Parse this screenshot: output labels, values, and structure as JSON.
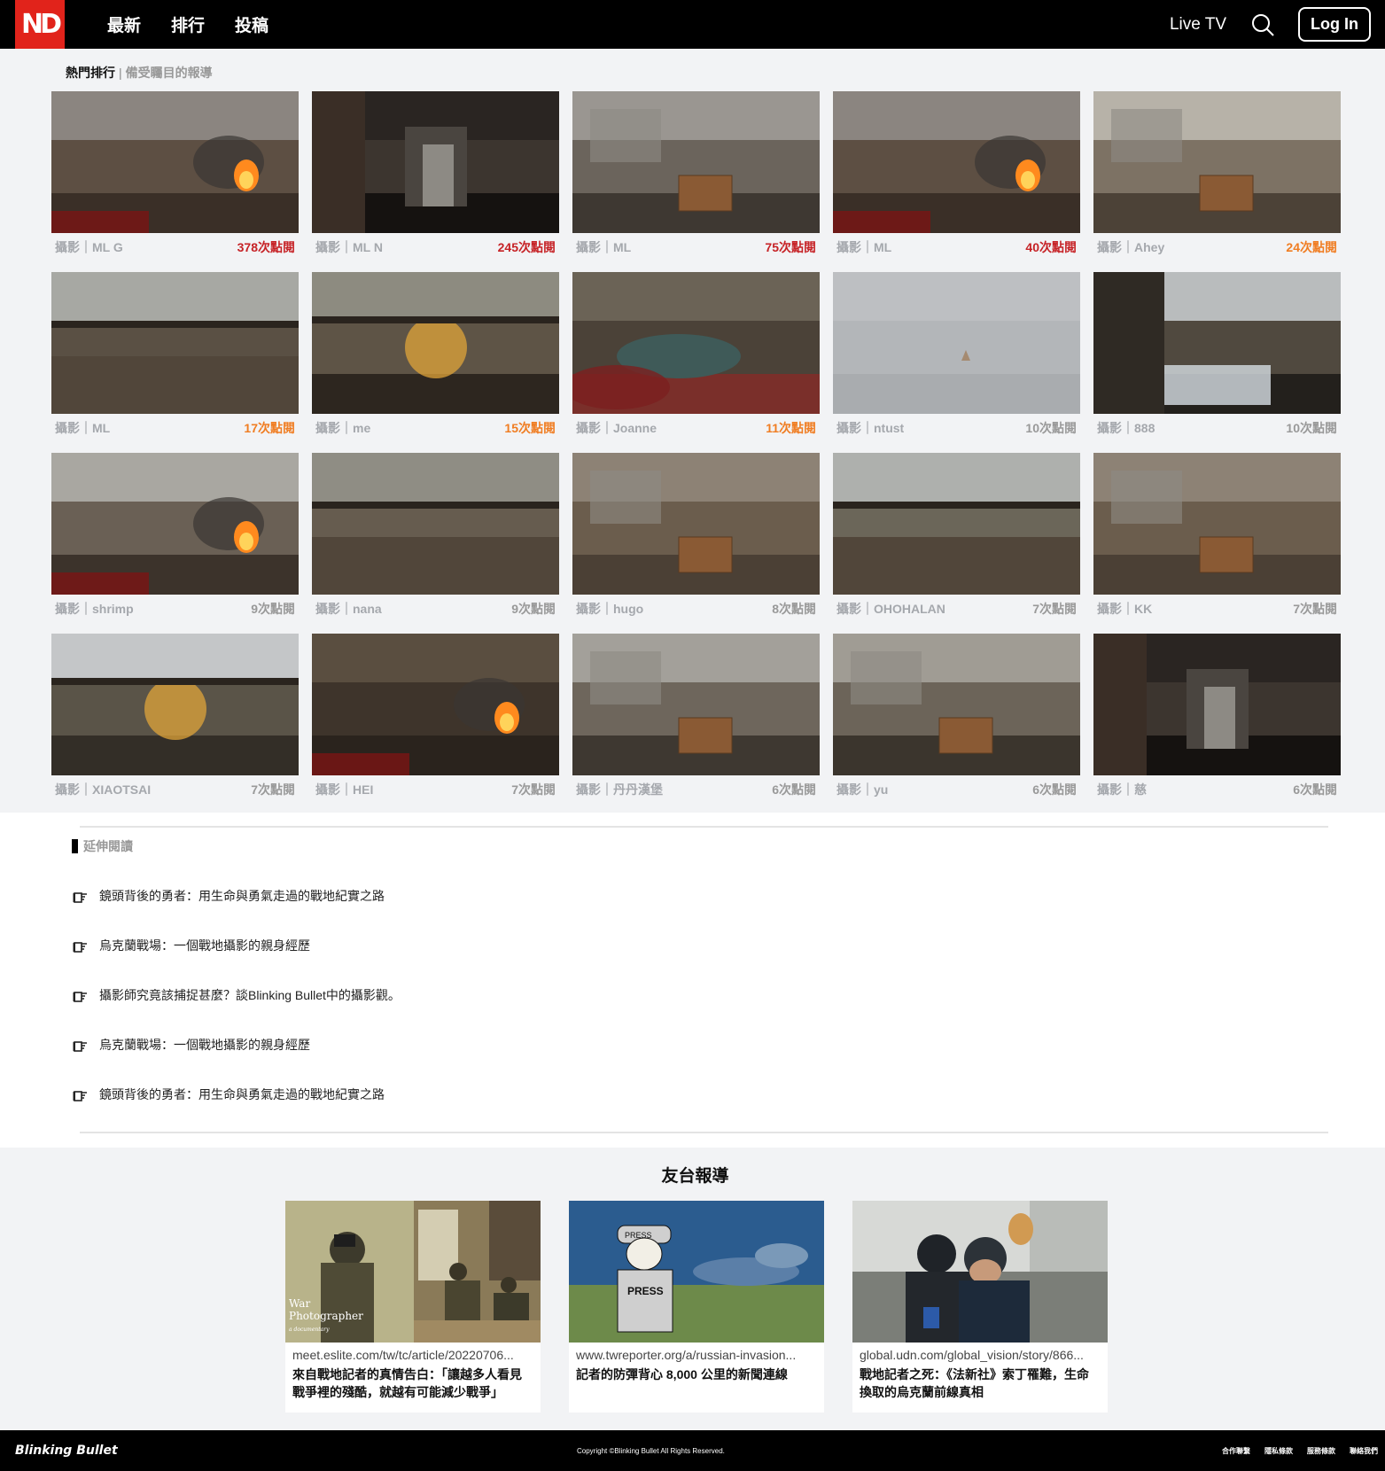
{
  "header": {
    "logo": "ND",
    "nav": [
      "最新",
      "排行",
      "投稿"
    ],
    "live": "Live TV",
    "login": "Log In"
  },
  "ranking": {
    "title": "熱門排行",
    "separator": "|",
    "subtitle": "備受矚目的報導",
    "cards": [
      {
        "who": "攝影｜ML G",
        "views": "378次點閱",
        "level": "red"
      },
      {
        "who": "攝影｜ML N",
        "views": "245次點閱",
        "level": "red"
      },
      {
        "who": "攝影｜ML",
        "views": "75次點閱",
        "level": "red"
      },
      {
        "who": "攝影｜ML",
        "views": "40次點閱",
        "level": "red"
      },
      {
        "who": "攝影｜Ahey",
        "views": "24次點閱",
        "level": "orange"
      },
      {
        "who": "攝影｜ML",
        "views": "17次點閱",
        "level": "orange"
      },
      {
        "who": "攝影｜me",
        "views": "15次點閱",
        "level": "orange"
      },
      {
        "who": "攝影｜Joanne",
        "views": "11次點閱",
        "level": "orange"
      },
      {
        "who": "攝影｜ntust",
        "views": "10次點閱",
        "level": "gray"
      },
      {
        "who": "攝影｜888",
        "views": "10次點閱",
        "level": "gray"
      },
      {
        "who": "攝影｜shrimp",
        "views": "9次點閱",
        "level": "gray"
      },
      {
        "who": "攝影｜nana",
        "views": "9次點閱",
        "level": "gray"
      },
      {
        "who": "攝影｜hugo",
        "views": "8次點閱",
        "level": "gray"
      },
      {
        "who": "攝影｜OHOHALAN",
        "views": "7次點閱",
        "level": "gray"
      },
      {
        "who": "攝影｜KK",
        "views": "7次點閱",
        "level": "gray"
      },
      {
        "who": "攝影｜XIAOTSAI",
        "views": "7次點閱",
        "level": "gray"
      },
      {
        "who": "攝影｜HEI",
        "views": "7次點閱",
        "level": "gray"
      },
      {
        "who": "攝影｜丹丹漢堡",
        "views": "6次點閱",
        "level": "gray"
      },
      {
        "who": "攝影｜yu",
        "views": "6次點閱",
        "level": "gray"
      },
      {
        "who": "攝影｜慈",
        "views": "6次點閱",
        "level": "gray"
      }
    ]
  },
  "reading": {
    "title": "延伸閱讀",
    "items": [
      "鏡頭背後的勇者：用生命與勇氣走過的戰地紀實之路",
      "烏克蘭戰場：一個戰地攝影的親身經歷",
      "攝影師究竟該捕捉甚麼？談Blinking Bullet中的攝影觀。",
      "烏克蘭戰場：一個戰地攝影的親身經歷",
      "鏡頭背後的勇者：用生命與勇氣走過的戰地紀實之路"
    ]
  },
  "friends": {
    "title": "友台報導",
    "cards": [
      {
        "url": "meet.eslite.com/tw/tc/article/20220706...",
        "title": "來自戰地記者的真情告白：「讓越多人看見戰爭裡的殘酷，就越有可能減少戰爭」",
        "image_text": [
          "War",
          "Photographer",
          "a documentary"
        ]
      },
      {
        "url": "www.twreporter.org/a/russian-invasion...",
        "title": "記者的防彈背心 8,000 公里的新聞連線",
        "image_text": [
          "PRESS",
          "PRESS"
        ]
      },
      {
        "url": "global.udn.com/global_vision/story/866...",
        "title": "戰地記者之死：《法新社》索丁罹難，生命換取的烏克蘭前線真相",
        "image_text": []
      }
    ]
  },
  "footer": {
    "brand": "Blinking Bullet",
    "copyright": "Copyright ©Blinking Bullet All Rights Reserved.",
    "links": [
      "合作聯繫",
      "隱私條款",
      "服務條款",
      "聯絡我們"
    ]
  },
  "colors": {
    "logo_red": "#e1231b",
    "views_red": "#c62226",
    "views_orange": "#f07d22",
    "views_gray": "#999999"
  },
  "icons": [
    "search-icon",
    "pointing-hand-icon"
  ]
}
